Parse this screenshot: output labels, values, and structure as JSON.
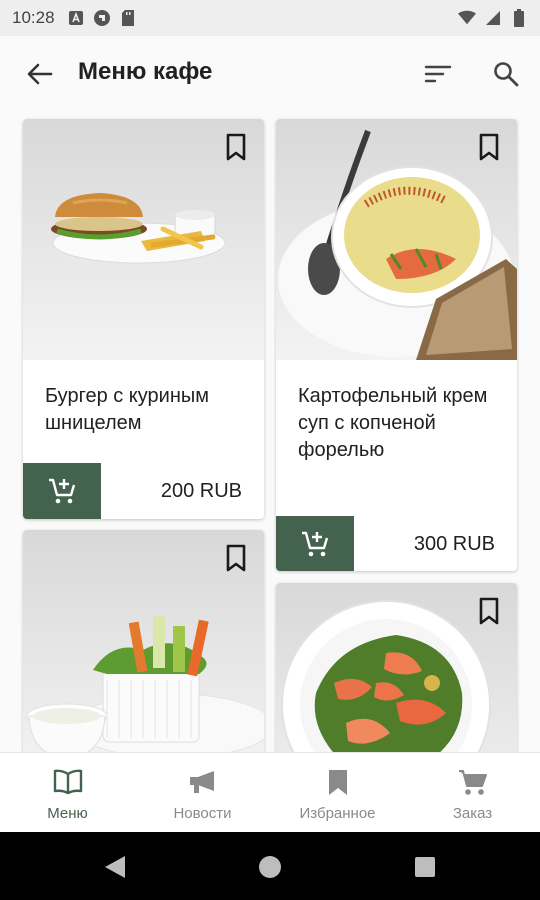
{
  "status_bar": {
    "time": "10:28"
  },
  "header": {
    "title": "Меню кафе"
  },
  "colors": {
    "accent": "#44634e",
    "inactive": "#8a8a8a"
  },
  "menu_items": [
    {
      "name": "Бургер с куриным шницелем",
      "price": "200 RUB"
    },
    {
      "name": "Картофельный крем суп с копченой форелью",
      "price": "300 RUB"
    },
    {
      "name": "",
      "price": ""
    },
    {
      "name": "",
      "price": ""
    }
  ],
  "bottom_nav": {
    "items": [
      {
        "label": "Меню",
        "icon": "book-icon",
        "active": true
      },
      {
        "label": "Новости",
        "icon": "megaphone-icon",
        "active": false
      },
      {
        "label": "Избранное",
        "icon": "bookmark-icon",
        "active": false
      },
      {
        "label": "Заказ",
        "icon": "cart-icon",
        "active": false
      }
    ]
  }
}
